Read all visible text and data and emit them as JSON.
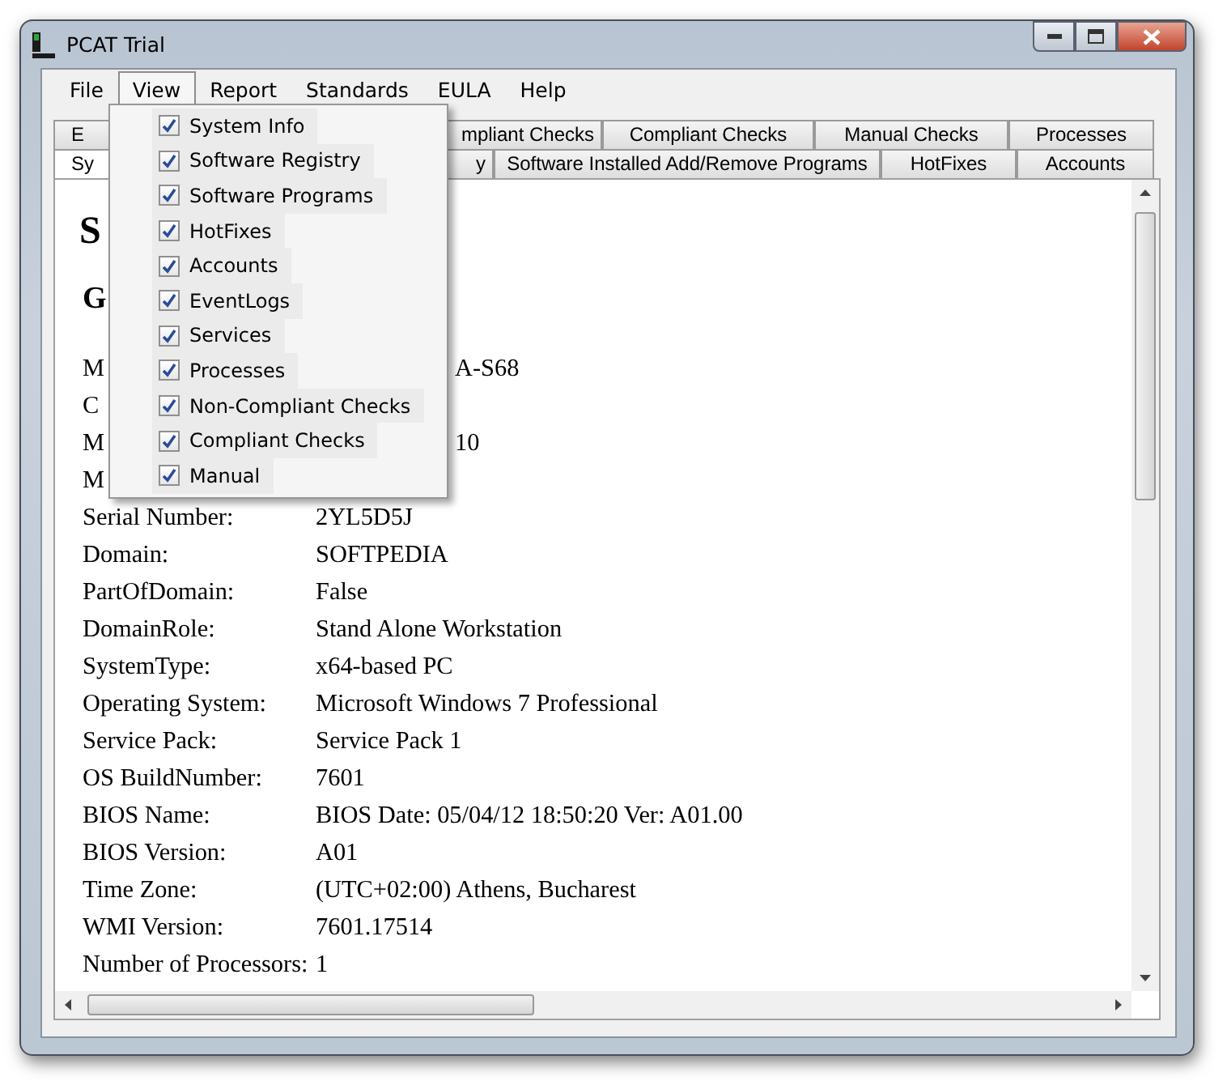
{
  "window": {
    "title": "PCAT Trial"
  },
  "menu_bar": [
    {
      "label": "File",
      "selected": false
    },
    {
      "label": "View",
      "selected": true
    },
    {
      "label": "Report",
      "selected": false
    },
    {
      "label": "Standards",
      "selected": false
    },
    {
      "label": "EULA",
      "selected": false
    },
    {
      "label": "Help",
      "selected": false
    }
  ],
  "view_menu": [
    {
      "label": "System Info",
      "checked": true
    },
    {
      "label": "Software Registry",
      "checked": true
    },
    {
      "label": "Software Programs",
      "checked": true
    },
    {
      "label": "HotFixes",
      "checked": true
    },
    {
      "label": "Accounts",
      "checked": true
    },
    {
      "label": "EventLogs",
      "checked": true
    },
    {
      "label": "Services",
      "checked": true
    },
    {
      "label": "Processes",
      "checked": true
    },
    {
      "label": "Non-Compliant Checks",
      "checked": true
    },
    {
      "label": "Compliant Checks",
      "checked": true
    },
    {
      "label": "Manual",
      "checked": true
    }
  ],
  "tabs_row_1": [
    {
      "label": "E",
      "selected": false
    },
    {
      "label": "mpliant Checks",
      "selected": false
    },
    {
      "label": "Compliant Checks",
      "selected": false
    },
    {
      "label": "Manual Checks",
      "selected": false
    },
    {
      "label": "Processes",
      "selected": false
    }
  ],
  "tabs_row_2": [
    {
      "label": "Sy",
      "selected": true
    },
    {
      "label": "y",
      "selected": false
    },
    {
      "label": "Software Installed Add/Remove Programs",
      "selected": false
    },
    {
      "label": "HotFixes",
      "selected": false
    },
    {
      "label": "Accounts",
      "selected": false
    }
  ],
  "content": {
    "heading": "S",
    "subheading": "G",
    "rows": [
      {
        "kind": "partly_hidden",
        "label": "M",
        "value": "A-S68"
      },
      {
        "kind": "partly_hidden",
        "label": "C"
      },
      {
        "kind": "partly_hidden",
        "label": "M",
        "value": "10"
      },
      {
        "kind": "partly_hidden",
        "label": "M"
      },
      {
        "kind": "full",
        "label": "Serial Number:",
        "value": "2YL5D5J"
      },
      {
        "kind": "full",
        "label": "Domain:",
        "value": "SOFTPEDIA"
      },
      {
        "kind": "full",
        "label": "PartOfDomain:",
        "value": "False"
      },
      {
        "kind": "full",
        "label": "DomainRole:",
        "value": "Stand Alone Workstation"
      },
      {
        "kind": "full",
        "label": "SystemType:",
        "value": "x64-based PC"
      },
      {
        "kind": "full",
        "label": "Operating System:",
        "value": "Microsoft Windows 7 Professional"
      },
      {
        "kind": "full",
        "label": "Service Pack:",
        "value": "Service Pack 1"
      },
      {
        "kind": "full",
        "label": "OS BuildNumber:",
        "value": "7601"
      },
      {
        "kind": "full",
        "label": "BIOS Name:",
        "value": "BIOS Date: 05/04/12 18:50:20 Ver: A01.00"
      },
      {
        "kind": "full",
        "label": "BIOS Version:",
        "value": "A01"
      },
      {
        "kind": "full",
        "label": "Time Zone:",
        "value": "(UTC+02:00) Athens, Bucharest"
      },
      {
        "kind": "full",
        "label": "WMI Version:",
        "value": "7601.17514"
      },
      {
        "kind": "full",
        "label": "Number of Processors:",
        "value": "1"
      }
    ]
  }
}
